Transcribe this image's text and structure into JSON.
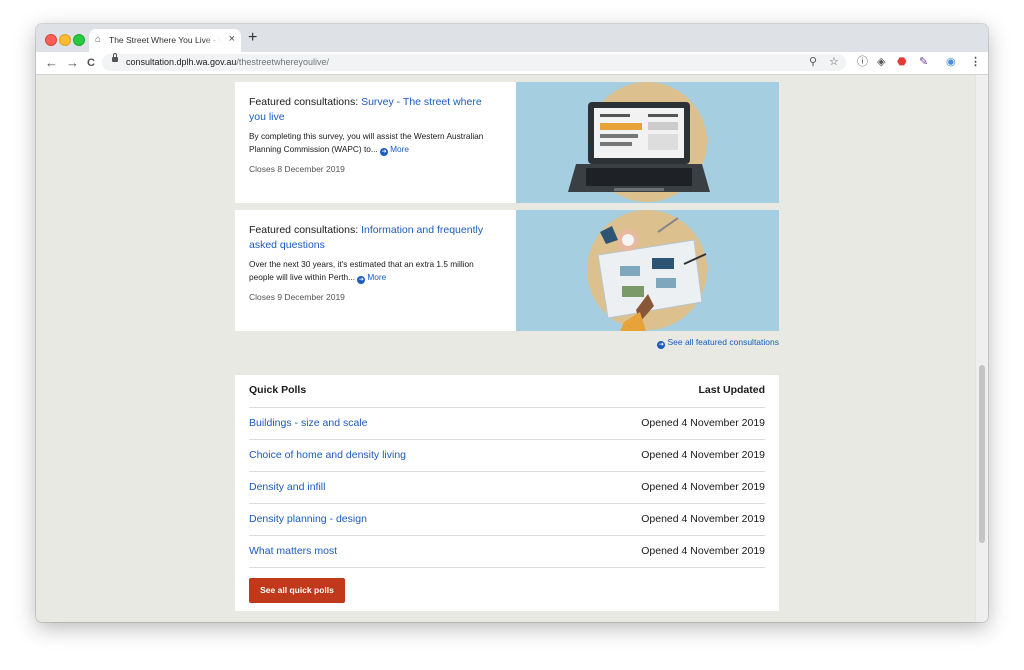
{
  "browser": {
    "tab_title": "The Street Where You Live - W",
    "tab_close": "×",
    "new_tab": "+",
    "url_domain": "consultation.dplh.wa.gov.au",
    "url_path": "/thestreetwhereyoulive/",
    "nav": {
      "back": "←",
      "forward": "→",
      "reload": "C"
    },
    "toolbar_icons": [
      "zoom-icon",
      "star-icon",
      "info-icon",
      "layers-icon",
      "stop-icon",
      "tool-icon",
      "avatar-icon",
      "menu-icon"
    ]
  },
  "featured": [
    {
      "prefix": "Featured consultations: ",
      "link": "Survey - The street where you live",
      "description": "By completing this survey, you will assist the Western Australian Planning Commission (WAPC) to...",
      "more": "More",
      "closes": "Closes 8 December 2019"
    },
    {
      "prefix": "Featured consultations: ",
      "link": "Information and frequently asked questions",
      "description": "Over the next 30 years, it's estimated that an extra 1.5 million people will live within Perth...",
      "more": "More",
      "closes": "Closes 9 December 2019"
    }
  ],
  "see_all_featured": "See all featured consultations",
  "quick_polls": {
    "header": "Quick Polls",
    "last_updated": "Last Updated",
    "rows": [
      {
        "name": "Buildings - size and scale",
        "date": "Opened 4 November 2019"
      },
      {
        "name": "Choice of home and density living",
        "date": "Opened 4 November 2019"
      },
      {
        "name": "Density and infill",
        "date": "Opened 4 November 2019"
      },
      {
        "name": "Density planning - design",
        "date": "Opened 4 November 2019"
      },
      {
        "name": "What matters most",
        "date": "Opened 4 November 2019"
      }
    ],
    "button": "See all quick polls"
  },
  "colors": {
    "link": "#1a5bbf",
    "button": "#c0391b",
    "page_bg": "#e9e9e4",
    "image_bg": "#a5cfe0"
  }
}
